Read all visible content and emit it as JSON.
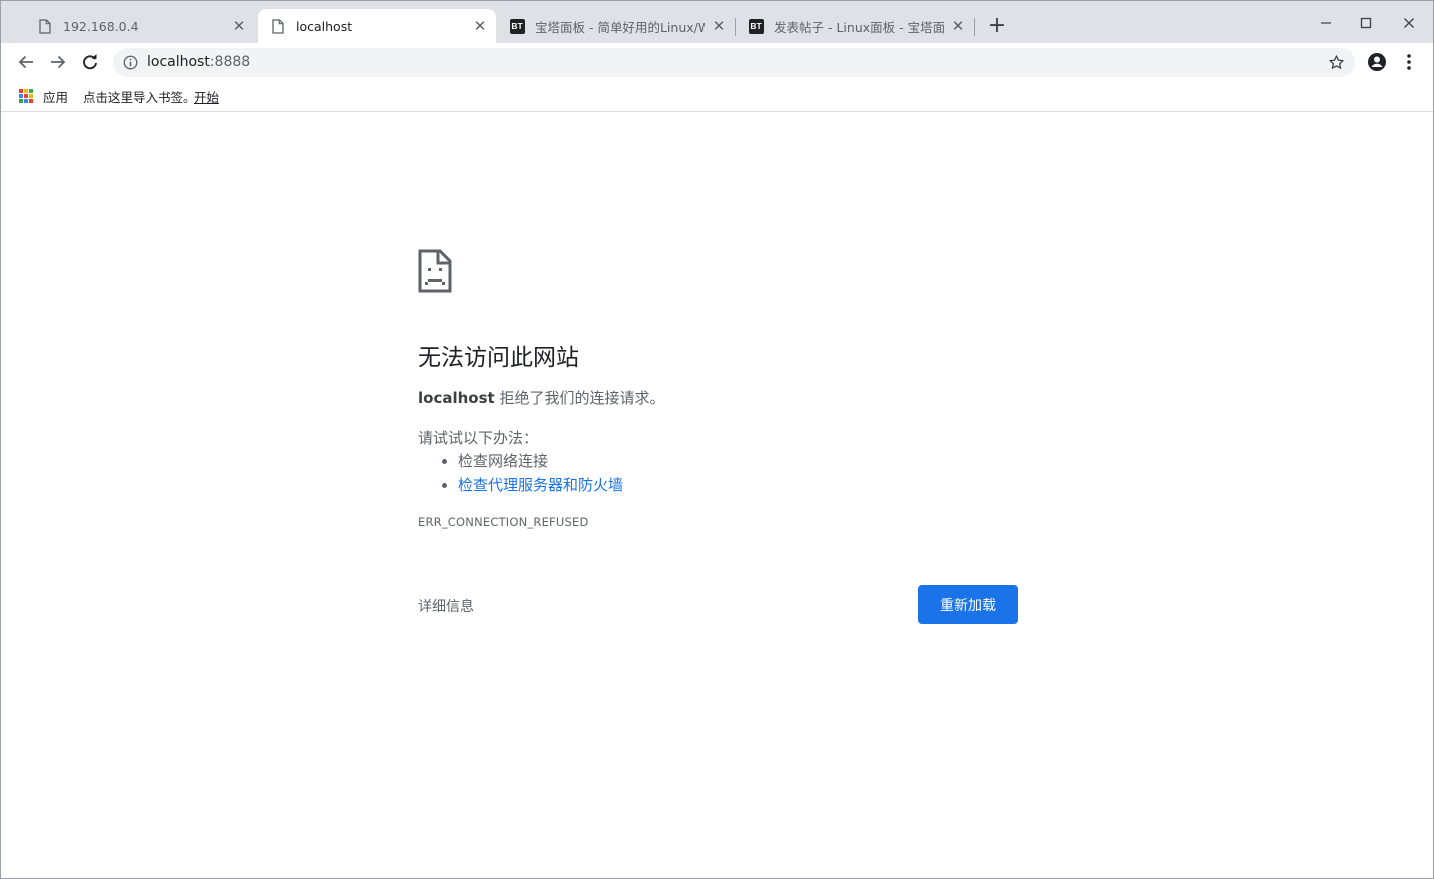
{
  "tabs": [
    {
      "title": "192.168.0.4",
      "icon": "page-icon",
      "active": false
    },
    {
      "title": "localhost",
      "icon": "page-icon",
      "active": true
    },
    {
      "title": "宝塔面板 - 简单好用的Linux/Win",
      "icon": "bt-icon",
      "active": false
    },
    {
      "title": "发表帖子 - Linux面板 - 宝塔面板",
      "icon": "bt-icon",
      "active": false
    }
  ],
  "bt_icon_text": "BT",
  "tab_close_glyph": "✕",
  "new_tab_glyph": "+",
  "address_bar": {
    "host": "localhost",
    "port": ":8888"
  },
  "bookmarks_bar": {
    "apps_label": "应用",
    "hint": "点击这里导入书签。",
    "link": "开始"
  },
  "error_page": {
    "title": "无法访问此网站",
    "summary_host": "localhost",
    "summary_text": " 拒绝了我们的连接请求。",
    "try_label": "请试试以下办法：",
    "suggestions": [
      "检查网络连接",
      "检查代理服务器和防火墙"
    ],
    "error_code": "ERR_CONNECTION_REFUSED",
    "details_label": "详细信息",
    "reload_label": "重新加载"
  },
  "colors": {
    "tabstrip": "#dee1e6",
    "accent": "#1a73e8",
    "apps_grid": [
      "#ea4335",
      "#fbbc04",
      "#34a853",
      "#4285f4",
      "#ea4335",
      "#fbbc04",
      "#34a853",
      "#4285f4",
      "#ea4335"
    ]
  }
}
